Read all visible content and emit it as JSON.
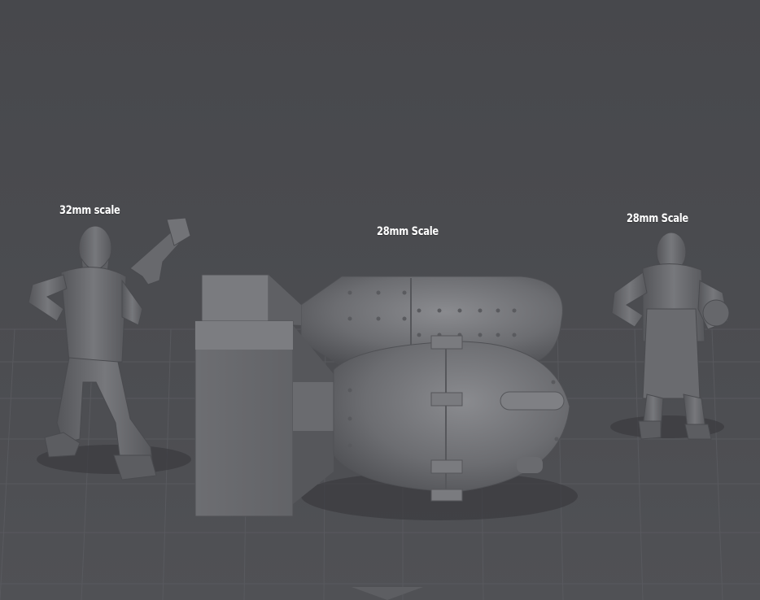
{
  "labels": {
    "left_figure": "32mm scale",
    "center_bomb": "28mm Scale",
    "right_figure": "28mm Scale"
  },
  "colors": {
    "background": "#4a4b4f",
    "grid_line": "#5a5b60",
    "model": "#6e6f73",
    "label_text": "#ffffff"
  },
  "objects": [
    "man-with-rifle-miniature",
    "twin-bomb-miniature",
    "blacksmith-in-apron-miniature"
  ]
}
